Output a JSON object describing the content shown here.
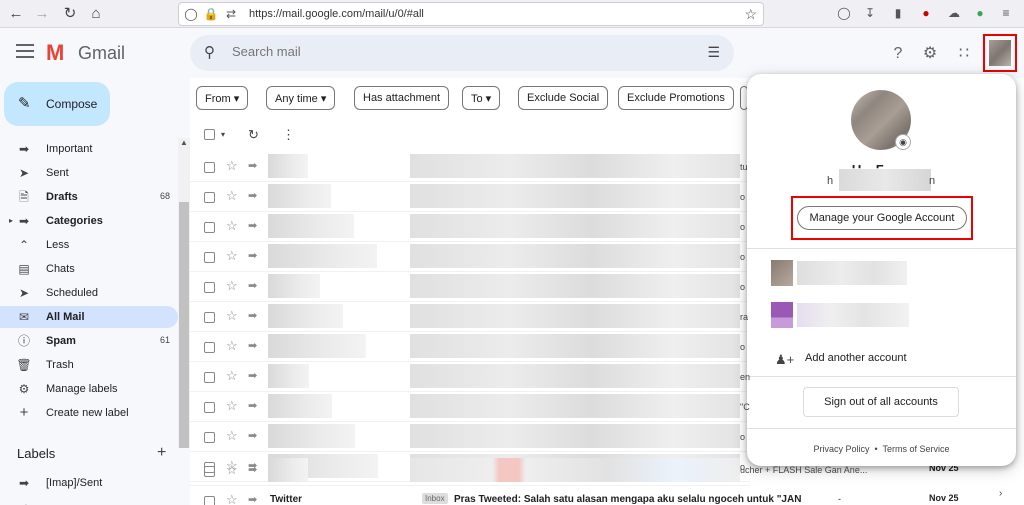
{
  "browser": {
    "url": "https://mail.google.com/mail/u/0/#all",
    "back_icon": "back-arrow-icon",
    "forward_icon": "forward-arrow-icon"
  },
  "header": {
    "app_name": "Gmail",
    "search_placeholder": "Search mail"
  },
  "sidebar": {
    "compose_label": "Compose",
    "items": [
      {
        "label": "Important",
        "count": "",
        "icon": "label-important-icon"
      },
      {
        "label": "Sent",
        "count": "",
        "icon": "send-icon"
      },
      {
        "label": "Drafts",
        "count": "68",
        "icon": "draft-icon"
      },
      {
        "label": "Categories",
        "count": "",
        "icon": "label-icon"
      },
      {
        "label": "Less",
        "count": "",
        "icon": "chevron-up-icon"
      },
      {
        "label": "Chats",
        "count": "",
        "icon": "chat-icon"
      },
      {
        "label": "Scheduled",
        "count": "",
        "icon": "schedule-icon"
      },
      {
        "label": "All Mail",
        "count": "",
        "icon": "mail-icon"
      },
      {
        "label": "Spam",
        "count": "61",
        "icon": "spam-icon"
      },
      {
        "label": "Trash",
        "count": "",
        "icon": "trash-icon"
      },
      {
        "label": "Manage labels",
        "count": "",
        "icon": "settings-icon"
      },
      {
        "label": "Create new label",
        "count": "",
        "icon": "plus-icon"
      }
    ],
    "labels_title": "Labels",
    "label_items": [
      {
        "label": "[Imap]/Sent"
      }
    ]
  },
  "filters": {
    "chips": [
      "From",
      "Any time",
      "Has attachment",
      "To",
      "Exclude Social",
      "Exclude Promotions"
    ]
  },
  "mail": {
    "rows_right_fragments": [
      "tu",
      "o",
      "o",
      "o",
      "o",
      "ra",
      "o",
      "en",
      "\"C",
      "o",
      "o",
      "ti",
      "o",
      "o",
      "ucher + FLASH Sale Gan Ane..."
    ],
    "dates": [
      "Nov 25",
      "Nov 25"
    ],
    "last_row": {
      "sender": "Twitter",
      "tag": "Inbox",
      "subject": "Pras Tweeted: Salah satu alasan mengapa aku selalu ngoceh untuk \"JAN",
      "tail": "-"
    }
  },
  "account_popup": {
    "name_partial": "U... F.... ...",
    "email_prefix": "h",
    "email_suffix": "n",
    "manage_label": "Manage your Google Account",
    "add_account_label": "Add another account",
    "signout_label": "Sign out of all accounts",
    "privacy_label": "Privacy Policy",
    "separator": "•",
    "terms_label": "Terms of Service"
  },
  "colors": {
    "compose_bg": "#c2e7ff",
    "active_item_bg": "#d3e3fd",
    "highlight_box": "#e00000"
  }
}
